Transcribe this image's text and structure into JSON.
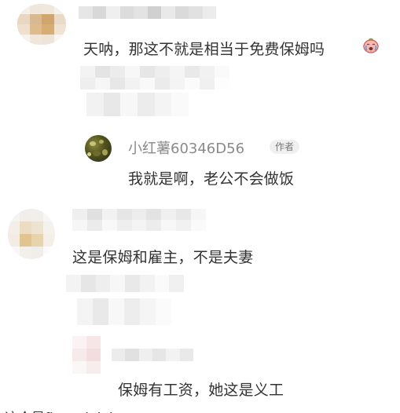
{
  "comments": [
    {
      "text": "天呐，那这不就是相当于免费保姆吗",
      "emoji": "crying-face-emoji"
    },
    {
      "text": "这是保姆和雇主，不是夫妻"
    },
    {
      "text": "保姆有工资，她这是义工"
    }
  ],
  "reply": {
    "username": "小红薯60346D56",
    "badge": "作者",
    "text": "我就是啊，老公不会做饭"
  },
  "bottom_partial_text": "这个是fine wink.h"
}
